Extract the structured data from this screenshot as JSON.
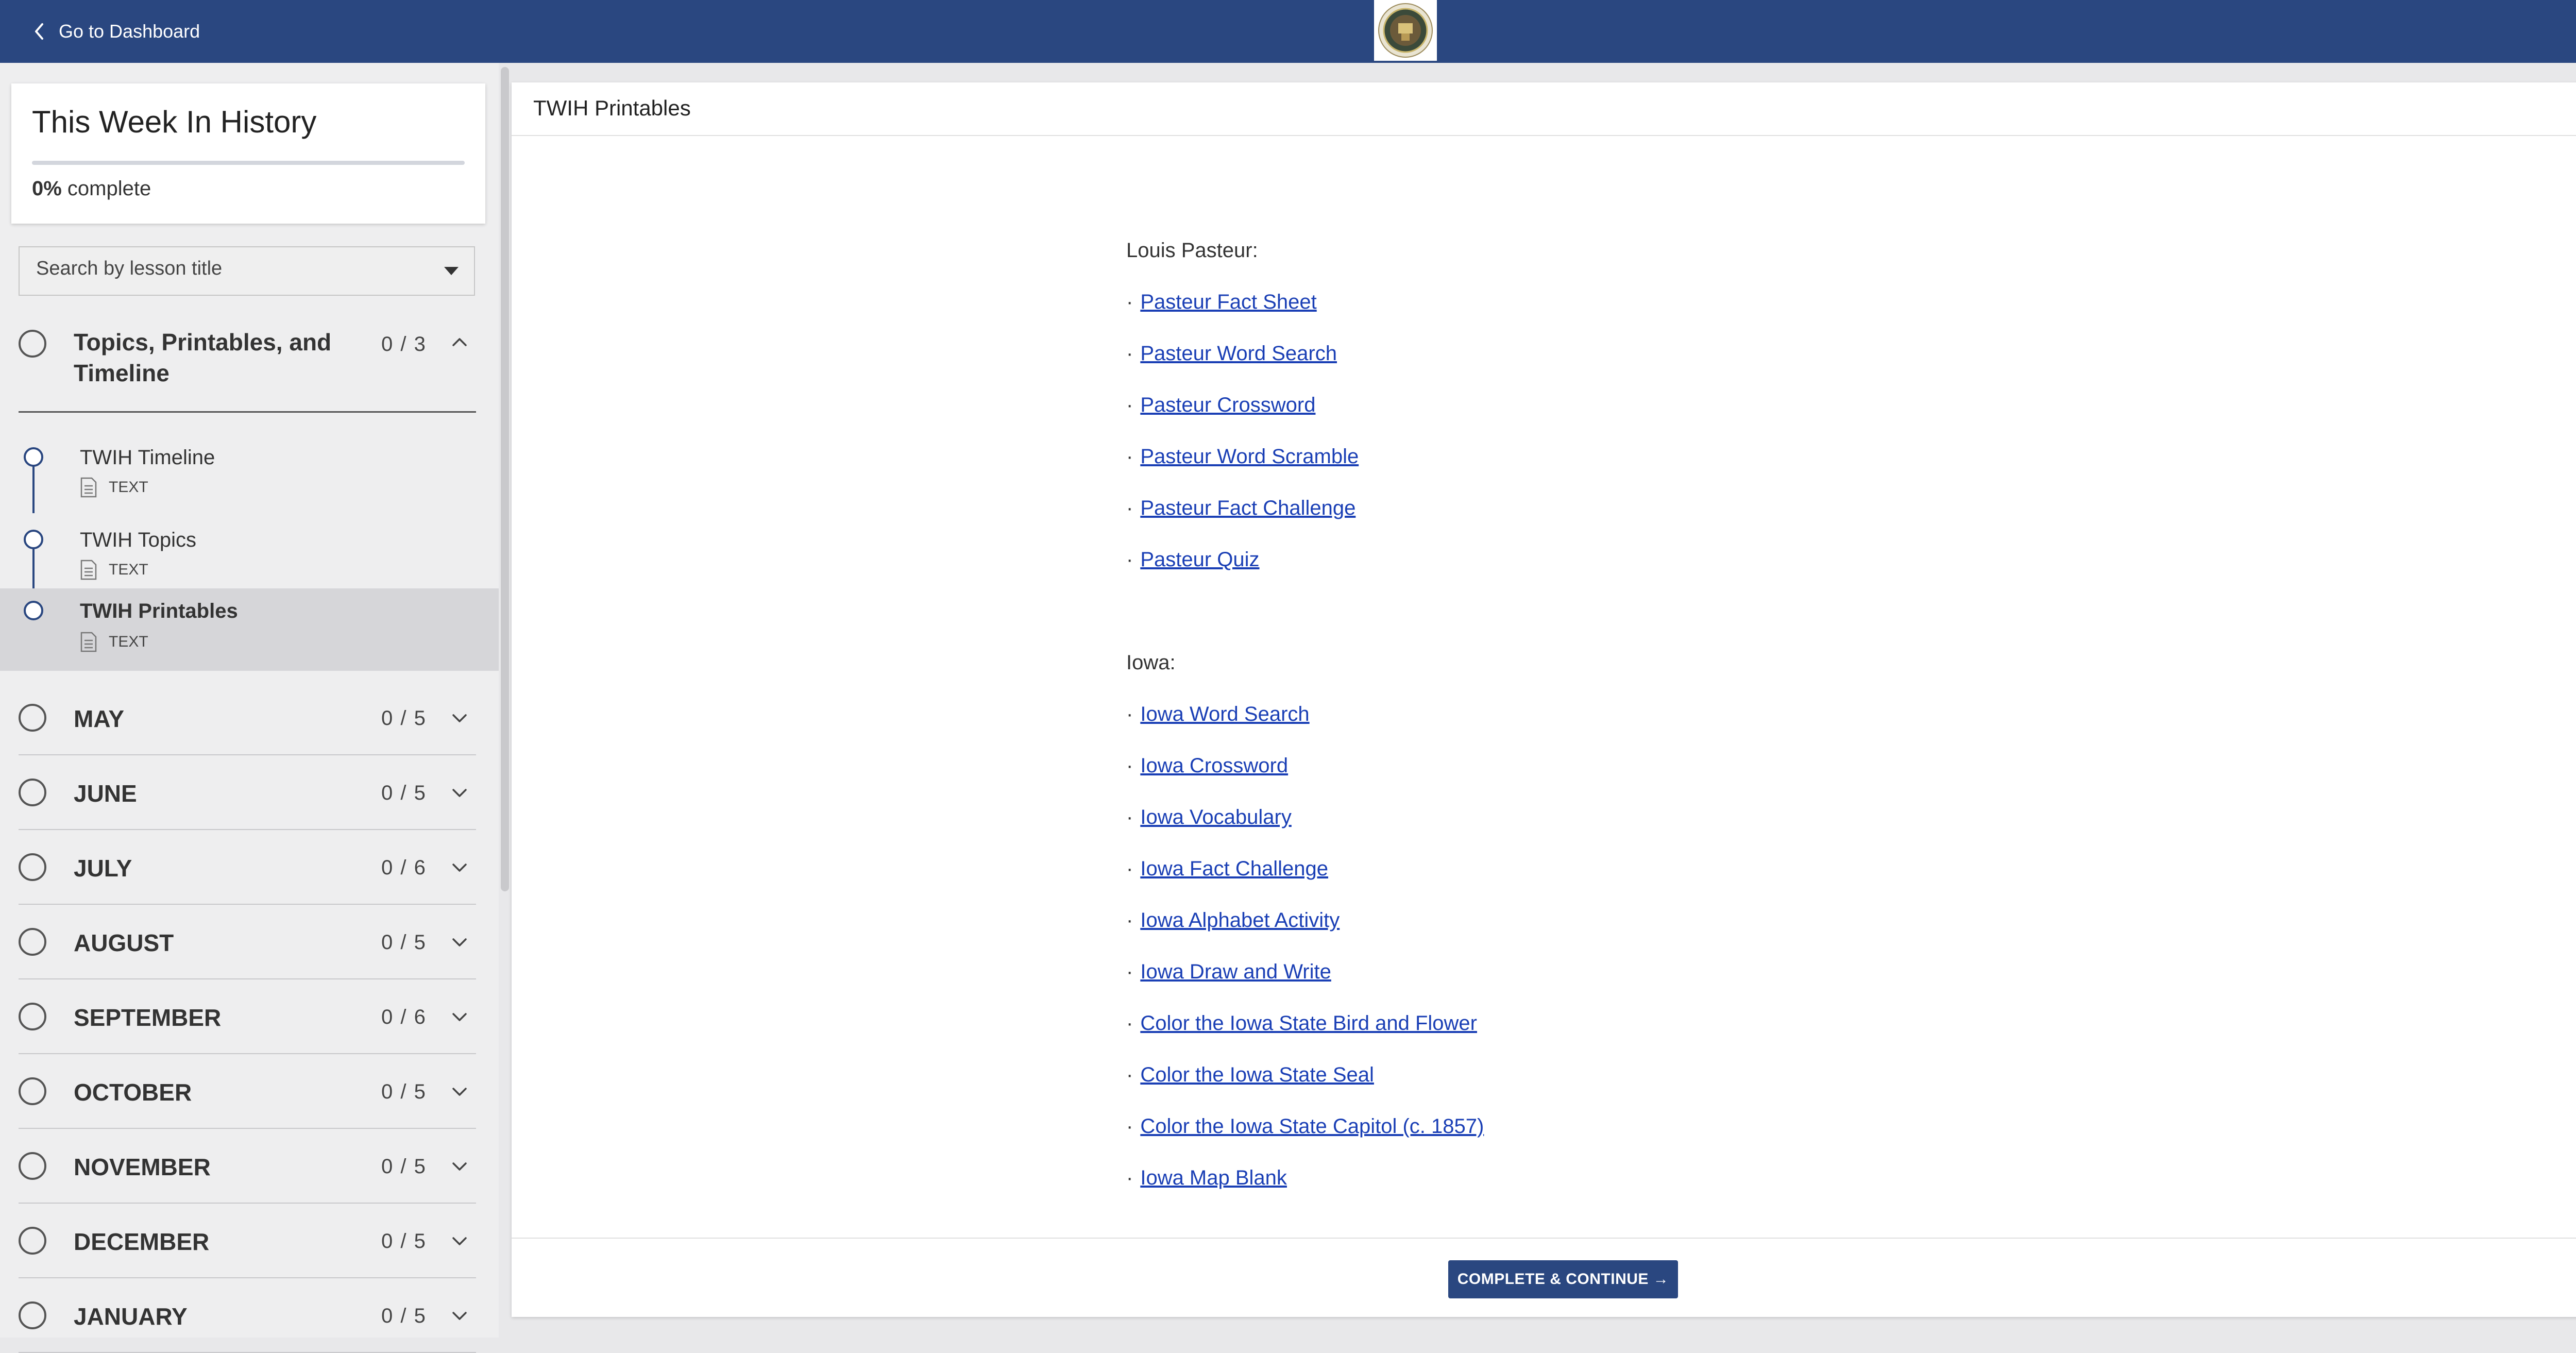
{
  "topbar": {
    "back_label": "Go to Dashboard",
    "logo_icon": "school-seal-icon",
    "bar_color": "#2a4780"
  },
  "sidebar": {
    "course_title": "This Week In History",
    "progress_percent": "0%",
    "progress_suffix": " complete",
    "progress_fraction": 0,
    "search_placeholder": "Search by lesson title",
    "open_section": {
      "title": "Topics, Printables, and Timeline",
      "count": "0 / 3",
      "lessons": [
        {
          "name": "TWIH Timeline",
          "type": "TEXT"
        },
        {
          "name": "TWIH Topics",
          "type": "TEXT"
        },
        {
          "name": "TWIH Printables",
          "type": "TEXT",
          "active": true
        }
      ]
    },
    "sections": [
      {
        "title": "MAY",
        "count": "0 / 5"
      },
      {
        "title": "JUNE",
        "count": "0 / 5"
      },
      {
        "title": "JULY",
        "count": "0 / 6"
      },
      {
        "title": "AUGUST",
        "count": "0 / 5"
      },
      {
        "title": "SEPTEMBER",
        "count": "0 / 6"
      },
      {
        "title": "OCTOBER",
        "count": "0 / 5"
      },
      {
        "title": "NOVEMBER",
        "count": "0 / 5"
      },
      {
        "title": "DECEMBER",
        "count": "0 / 5"
      },
      {
        "title": "JANUARY",
        "count": "0 / 5"
      }
    ]
  },
  "panel": {
    "title": "TWIH Printables",
    "bullet": "·",
    "groups": [
      {
        "label": "Louis Pasteur:",
        "links": [
          "Pasteur Fact Sheet",
          "Pasteur Word Search",
          "Pasteur Crossword",
          "Pasteur Word Scramble",
          "Pasteur Fact Challenge",
          "Pasteur Quiz"
        ]
      },
      {
        "label": "Iowa:",
        "links": [
          "Iowa Word Search",
          "Iowa Crossword",
          "Iowa Vocabulary",
          "Iowa Fact Challenge",
          "Iowa Alphabet Activity",
          "Iowa Draw and Write",
          "Color the Iowa State Bird and Flower",
          "Color the Iowa State Seal",
          "Color the Iowa State Capitol (c. 1857)",
          "Iowa Map Blank"
        ]
      }
    ],
    "complete_button": "COMPLETE & CONTINUE →"
  }
}
